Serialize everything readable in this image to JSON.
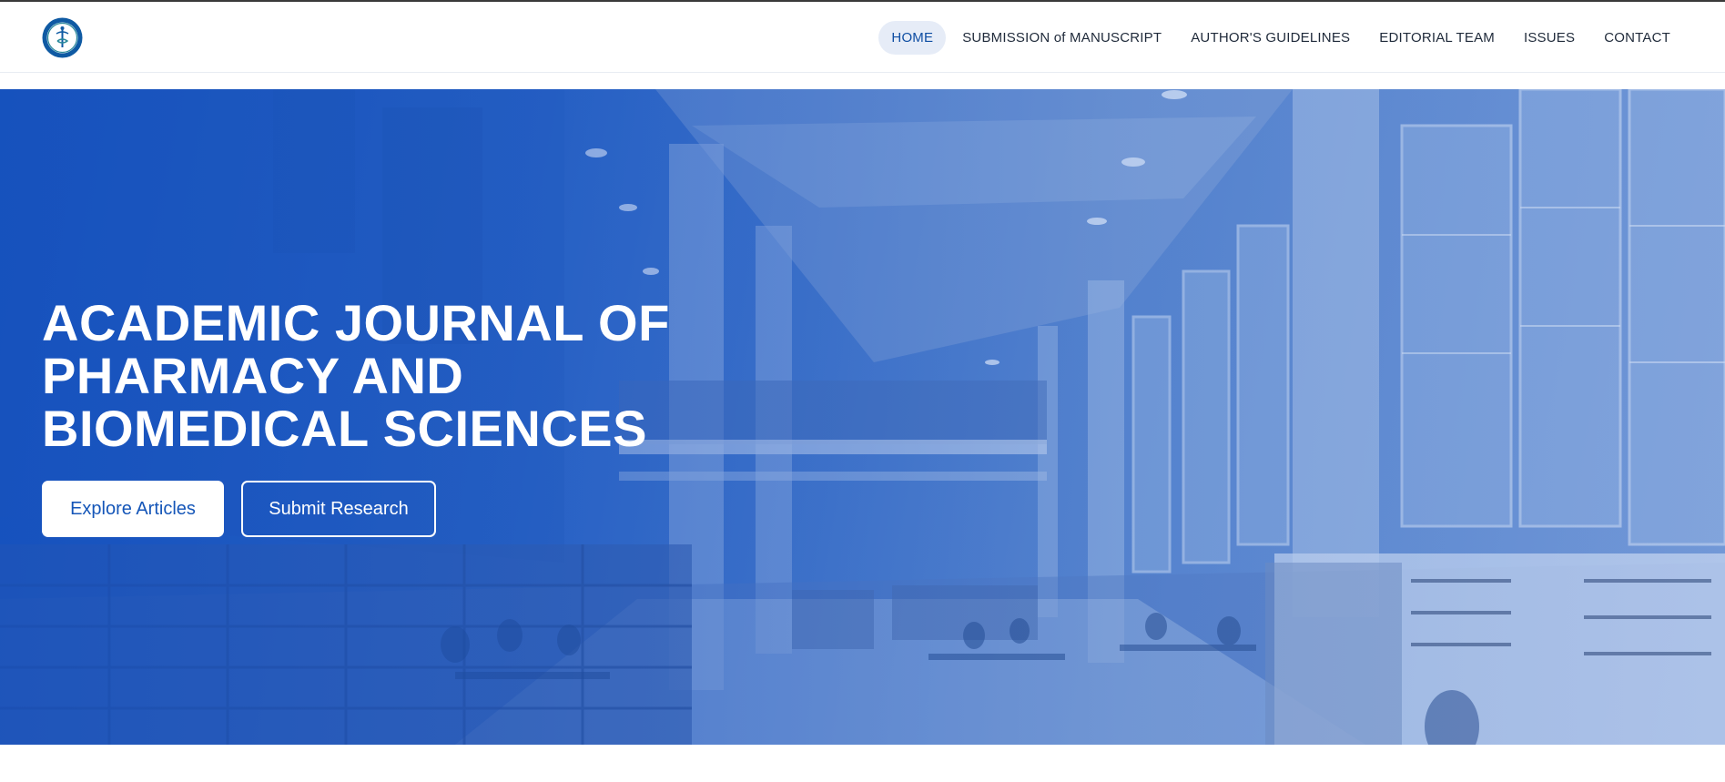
{
  "brand": {
    "logo_icon": "journal-seal-logo"
  },
  "nav": {
    "items": [
      {
        "label": "HOME",
        "active": true
      },
      {
        "label": "SUBMISSION of MANUSCRIPT",
        "active": false
      },
      {
        "label": "AUTHOR'S GUIDELINES",
        "active": false
      },
      {
        "label": "EDITORIAL TEAM",
        "active": false
      },
      {
        "label": "ISSUES",
        "active": false
      },
      {
        "label": "CONTACT",
        "active": false
      }
    ]
  },
  "hero": {
    "title": "ACADEMIC JOURNAL OF PHARMACY AND BIOMEDICAL SCIENCES",
    "primary_button": "Explore Articles",
    "secondary_button": "Submit Research",
    "background_image": "library-interior-photo"
  },
  "colors": {
    "accent": "#1556b8",
    "nav_active_bg": "#e6ecf7",
    "hero_tint": "#1a55bd"
  }
}
